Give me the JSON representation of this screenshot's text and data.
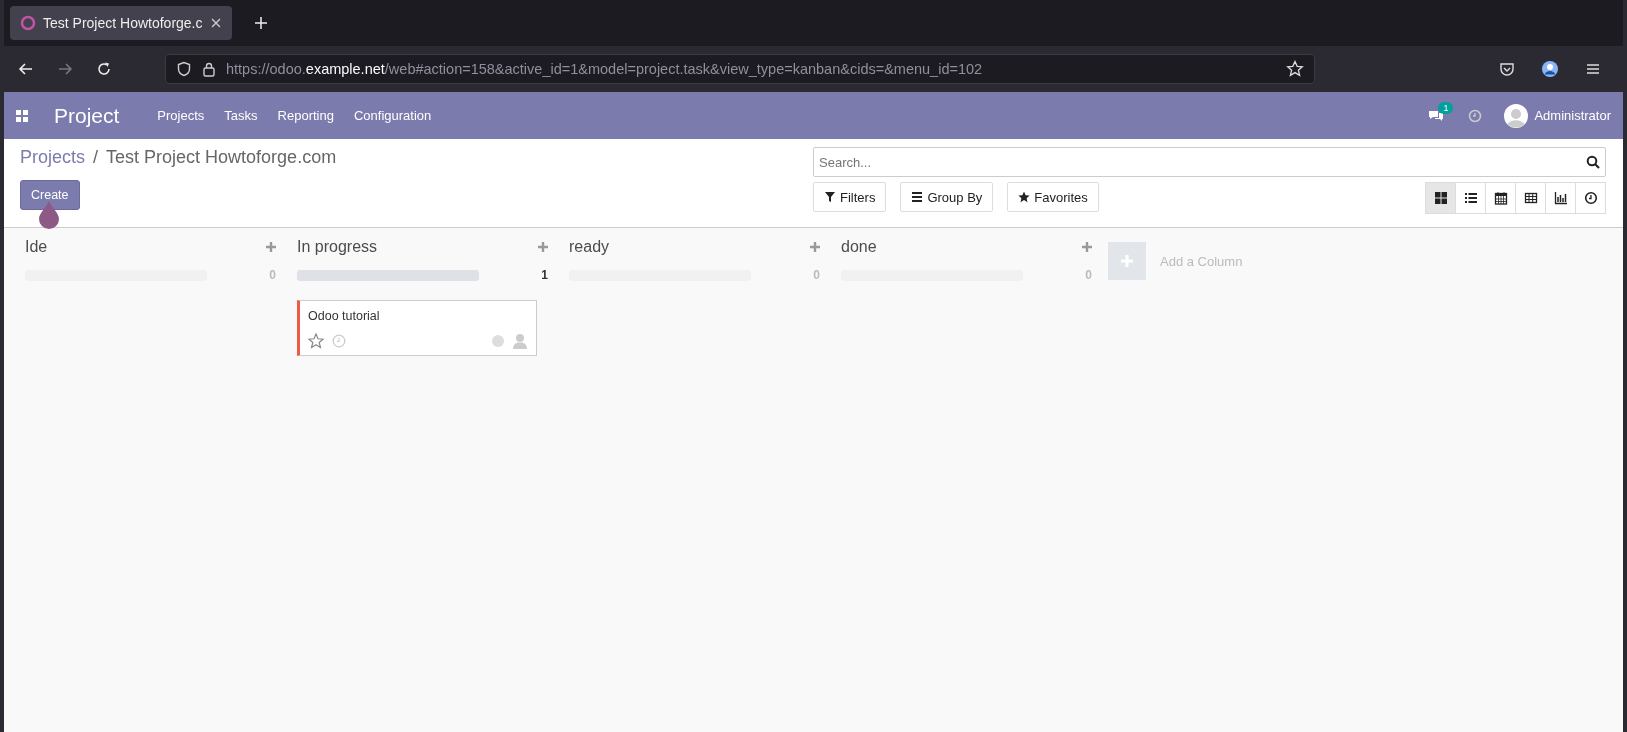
{
  "browser": {
    "tab": {
      "title": "Test Project Howtoforge.c",
      "selected": true
    },
    "url": {
      "host_prefix": "https://odoo.",
      "host": "example.net",
      "path": "/web#action=158&active_id=1&model=project.task&view_type=kanban&cids=&menu_id=102"
    }
  },
  "navbar": {
    "app": "Project",
    "menu": [
      "Projects",
      "Tasks",
      "Reporting",
      "Configuration"
    ],
    "messages_badge": "1",
    "user": "Administrator"
  },
  "breadcrumb": {
    "parent": "Projects",
    "separator": "/",
    "current": "Test Project Howtoforge.com"
  },
  "create_button": "Create",
  "search": {
    "placeholder": "Search..."
  },
  "filters": [
    {
      "kind": "filter",
      "label": "Filters"
    },
    {
      "kind": "group",
      "label": "Group By"
    },
    {
      "kind": "favorite",
      "label": "Favorites"
    }
  ],
  "views": [
    {
      "kind": "kanban",
      "selected": true
    },
    {
      "kind": "list",
      "selected": false
    },
    {
      "kind": "calendar",
      "selected": false
    },
    {
      "kind": "pivot",
      "selected": false
    },
    {
      "kind": "graph",
      "selected": false
    },
    {
      "kind": "activity",
      "selected": false
    }
  ],
  "columns": [
    {
      "title": "Ide",
      "count": "0",
      "level": 0
    },
    {
      "title": "In progress",
      "count": "1",
      "level": 1,
      "cards": [
        {
          "title": "Odoo tutorial",
          "starred": false
        }
      ]
    },
    {
      "title": "ready",
      "count": "0",
      "level": 0
    },
    {
      "title": "done",
      "count": "0",
      "level": 0
    }
  ],
  "add_column": "Add a Column"
}
